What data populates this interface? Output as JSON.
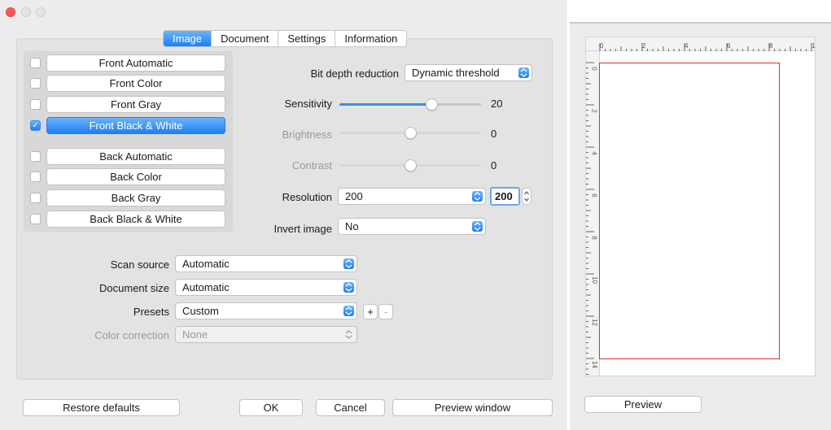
{
  "tabs": [
    {
      "label": "Image",
      "active": true
    },
    {
      "label": "Document",
      "active": false
    },
    {
      "label": "Settings",
      "active": false
    },
    {
      "label": "Information",
      "active": false
    }
  ],
  "image_modes": {
    "front": [
      {
        "label": "Front Automatic",
        "checked": false
      },
      {
        "label": "Front Color",
        "checked": false
      },
      {
        "label": "Front Gray",
        "checked": false
      },
      {
        "label": "Front Black & White",
        "checked": true
      }
    ],
    "back": [
      {
        "label": "Back Automatic",
        "checked": false
      },
      {
        "label": "Back Color",
        "checked": false
      },
      {
        "label": "Back Gray",
        "checked": false
      },
      {
        "label": "Back Black & White",
        "checked": false
      }
    ]
  },
  "bit_depth": {
    "label": "Bit depth reduction",
    "value": "Dynamic threshold"
  },
  "sliders": [
    {
      "label": "Sensitivity",
      "value": "20",
      "level": 0.65,
      "enabled": true
    },
    {
      "label": "Brightness",
      "value": "0",
      "level": 0.5,
      "enabled": false
    },
    {
      "label": "Contrast",
      "value": "0",
      "level": 0.5,
      "enabled": false
    }
  ],
  "resolution": {
    "label": "Resolution",
    "value": "200",
    "stepper_value": "200"
  },
  "invert": {
    "label": "Invert image",
    "value": "No"
  },
  "scan_source": {
    "label": "Scan source",
    "value": "Automatic"
  },
  "document_size": {
    "label": "Document size",
    "value": "Automatic"
  },
  "presets": {
    "label": "Presets",
    "value": "Custom",
    "add": "+",
    "remove": "-"
  },
  "color_correction": {
    "label": "Color correction",
    "value": "None"
  },
  "footer": {
    "restore": "Restore defaults",
    "ok": "OK",
    "cancel": "Cancel",
    "preview_window": "Preview window"
  },
  "preview": {
    "button": "Preview",
    "ruler_h": [
      "0",
      "2",
      "4",
      "6",
      "8",
      "1"
    ],
    "ruler_v": [
      "0",
      "2",
      "4",
      "6",
      "8",
      "10",
      "12",
      "14"
    ]
  },
  "colors": {
    "accent": "#1d7ff3",
    "page_border": "#e0302c",
    "close": "#fc5753"
  }
}
